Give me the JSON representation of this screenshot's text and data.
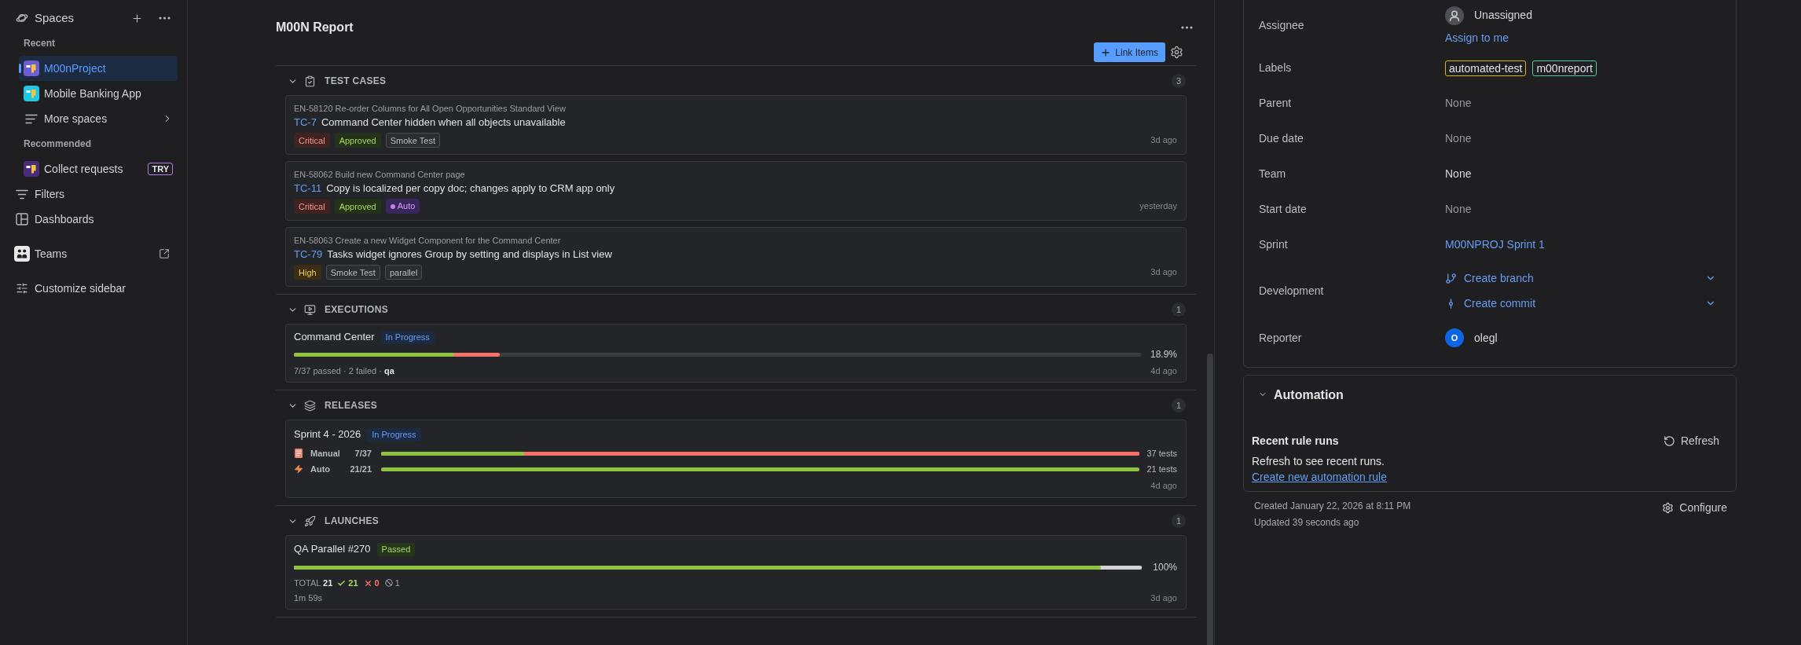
{
  "sidebar": {
    "title": "Spaces",
    "recent": {
      "heading": "Recent",
      "items": [
        {
          "label": "M00nProject",
          "selected": true,
          "color": "#6e5dd3"
        },
        {
          "label": "Mobile Banking App",
          "selected": false,
          "color": "#1ec8e6"
        }
      ],
      "more": "More spaces"
    },
    "recommended": {
      "heading": "Recommended",
      "items": [
        {
          "label": "Collect requests",
          "selected": false,
          "color": "#4a2a7a",
          "badge": "TRY"
        }
      ]
    },
    "nav_groups": [
      {
        "items": [
          {
            "label": "Filters",
            "kind": "filters",
            "selected": false,
            "external": false
          },
          {
            "label": "Dashboards",
            "kind": "dashboards",
            "selected": false,
            "external": false
          }
        ]
      },
      {
        "items": [
          {
            "label": "Teams",
            "kind": "teams",
            "selected": false,
            "external": true
          }
        ]
      },
      {
        "items": [
          {
            "label": "Customize sidebar",
            "kind": "customize",
            "selected": false,
            "external": false
          }
        ]
      }
    ]
  },
  "report": {
    "title": "M00N Report",
    "link_button": "Link Items",
    "sections": [
      {
        "kind": "test_cases",
        "heading": "TEST CASES",
        "count": "3",
        "expanded": true,
        "items": [
          {
            "parent": "EN-58120 Re-order Columns for All Open Opportunities Standard View",
            "key": "TC-7",
            "title": "Command Center hidden when all objects unavailable",
            "tags": [
              {
                "label": "Critical",
                "kind": "critical"
              },
              {
                "label": "Approved",
                "kind": "approved"
              },
              {
                "label": "Smoke Test",
                "kind": "plain"
              }
            ],
            "time": "3d ago"
          },
          {
            "parent": "EN-58062 Build new Command Center page",
            "key": "TC-11",
            "title": "Copy is localized per copy doc; changes apply to CRM app only",
            "tags": [
              {
                "label": "Critical",
                "kind": "critical"
              },
              {
                "label": "Approved",
                "kind": "approved"
              },
              {
                "label": "Auto",
                "kind": "auto"
              }
            ],
            "time": "yesterday"
          },
          {
            "parent": "EN-58063 Create a new Widget Component for the Command Center",
            "key": "TC-79",
            "title": "Tasks widget ignores Group by setting and displays in List view",
            "tags": [
              {
                "label": "High",
                "kind": "high"
              },
              {
                "label": "Smoke Test",
                "kind": "plain"
              },
              {
                "label": "parallel",
                "kind": "plain"
              }
            ],
            "time": "3d ago"
          }
        ]
      },
      {
        "kind": "executions",
        "heading": "EXECUTIONS",
        "count": "1",
        "expanded": true,
        "items": [
          {
            "name": "Command Center",
            "status": {
              "label": "In Progress",
              "kind": "progress"
            },
            "bar": {
              "kind": "untested",
              "fills": [
                {
                  "kind": "executed",
                  "level": 0.243
                },
                {
                  "kind": "passed",
                  "level": 0.189
                }
              ]
            },
            "reading": "18.9%",
            "meta": "7/37 passed · 2 failed · **qa**",
            "time": "4d ago"
          }
        ]
      },
      {
        "kind": "releases",
        "heading": "RELEASES",
        "count": "1",
        "expanded": true,
        "items": [
          {
            "name": "Sprint 4 - 2026",
            "status": {
              "label": "In Progress",
              "kind": "progress"
            },
            "rows": [
              {
                "kind": "manual",
                "label": "Manual",
                "count": "7/37",
                "bar": {
                  "kind": "failed",
                  "fills": [
                    {
                      "kind": "passed",
                      "level": 0.189
                    }
                  ]
                },
                "reading": "37 tests"
              },
              {
                "kind": "auto",
                "label": "Auto",
                "count": "21/21",
                "bar": {
                  "kind": "untested",
                  "fills": [
                    {
                      "kind": "passed",
                      "level": 1
                    }
                  ]
                },
                "reading": "21 tests"
              }
            ],
            "time": "4d ago"
          }
        ]
      },
      {
        "kind": "launches",
        "heading": "LAUNCHES",
        "count": "1",
        "expanded": true,
        "items": [
          {
            "name": "QA Parallel #270",
            "status": {
              "label": "Passed",
              "kind": "passed"
            },
            "bar": {
              "kind": "skipped",
              "fills": [
                {
                  "kind": "passed",
                  "level": 0.952
                }
              ]
            },
            "reading": "100%",
            "total": "TOTAL **21**",
            "passed": "21",
            "failed": "0",
            "skipped": "1",
            "duration": "1m 59s",
            "time": "3d ago"
          }
        ]
      }
    ]
  },
  "details": {
    "fields": [
      {
        "label": "Assignee",
        "kind": "assignee",
        "value": "Unassigned",
        "action": "Assign to me"
      },
      {
        "label": "Labels",
        "kind": "labels",
        "labels": [
          {
            "text": "automated-test",
            "color": "#e2b203"
          },
          {
            "text": "m00nreport",
            "color": "#4bce97"
          }
        ]
      },
      {
        "label": "Parent",
        "kind": "empty",
        "value": "None"
      },
      {
        "label": "Due date",
        "kind": "empty",
        "value": "None"
      },
      {
        "label": "Team",
        "kind": "text",
        "value": "None"
      },
      {
        "label": "Start date",
        "kind": "empty",
        "value": "None"
      },
      {
        "label": "Sprint",
        "kind": "link",
        "value": "M00NPROJ Sprint 1"
      },
      {
        "label": "Development",
        "kind": "dev",
        "actions": [
          {
            "label": "Create branch",
            "kind": "branch"
          },
          {
            "label": "Create commit",
            "kind": "commit"
          }
        ]
      },
      {
        "label": "Reporter",
        "kind": "user",
        "value": "olegl",
        "initial": "O"
      }
    ]
  },
  "automation": {
    "title": "Automation",
    "expanded": true,
    "heading": "Recent rule runs",
    "refresh": "Refresh",
    "message": "Refresh to see recent runs.",
    "link": "Create new automation rule"
  },
  "footer": {
    "created": "Created January 22, 2026 at 8:11 PM",
    "updated": "Updated 39 seconds ago",
    "configure": "Configure"
  }
}
